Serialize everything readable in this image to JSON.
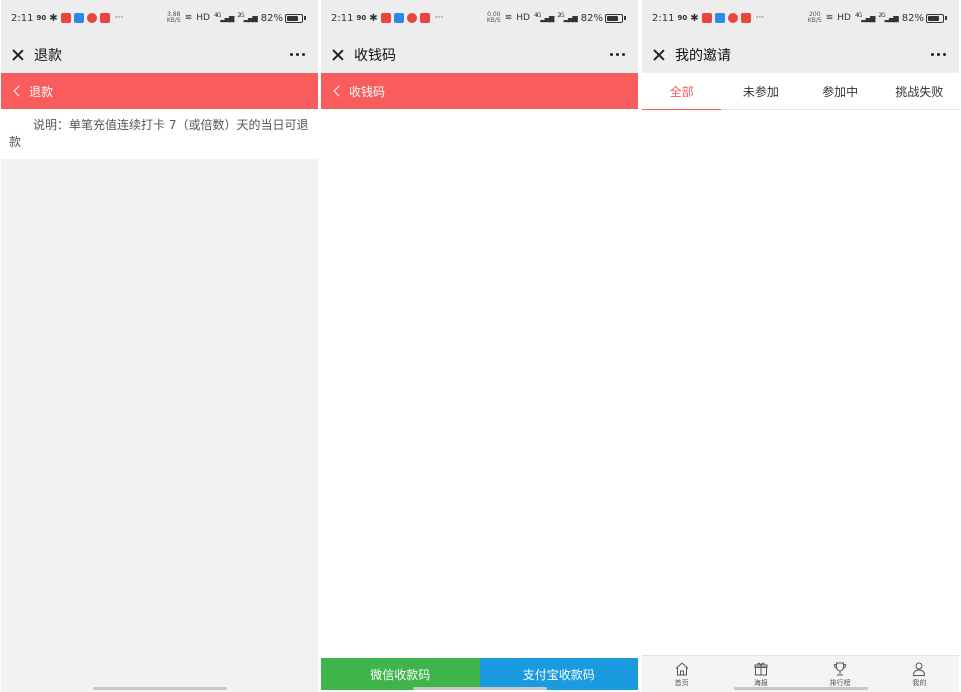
{
  "status_bars": [
    {
      "time": "2:11",
      "net": "90",
      "speed_top": "3.88",
      "speed_unit": "KB/S",
      "hd": "HD",
      "sig1": "4G",
      "sig2": "2G",
      "battery": "82%",
      "battery_level": 0.82
    },
    {
      "time": "2:11",
      "net": "90",
      "speed_top": "0.00",
      "speed_unit": "KB/S",
      "hd": "HD",
      "sig1": "4G",
      "sig2": "2G",
      "battery": "82%",
      "battery_level": 0.82
    },
    {
      "time": "2:11",
      "net": "90",
      "speed_top": "200",
      "speed_unit": "KB/S",
      "hd": "HD",
      "sig1": "4G",
      "sig2": "2G",
      "battery": "82%",
      "battery_level": 0.82
    }
  ],
  "screen1": {
    "title": "退款",
    "header": "退款",
    "notice": "说明：单笔充值连续打卡 7（或倍数）天的当日可退款"
  },
  "screen2": {
    "title": "收钱码",
    "header": "收钱码",
    "wechat_button": "微信收款码",
    "alipay_button": "支付宝收款码"
  },
  "screen3": {
    "title": "我的邀请",
    "tabs": [
      "全部",
      "未参加",
      "参加中",
      "挑战失败"
    ],
    "nav": [
      {
        "label": "首页",
        "icon": "home-icon"
      },
      {
        "label": "海报",
        "icon": "gift-icon"
      },
      {
        "label": "排行榜",
        "icon": "trophy-icon"
      },
      {
        "label": "我的",
        "icon": "person-icon"
      }
    ]
  },
  "colors": {
    "accent_red": "#f85c5c",
    "wechat_green": "#3fb44a",
    "alipay_blue": "#1a9be0"
  }
}
